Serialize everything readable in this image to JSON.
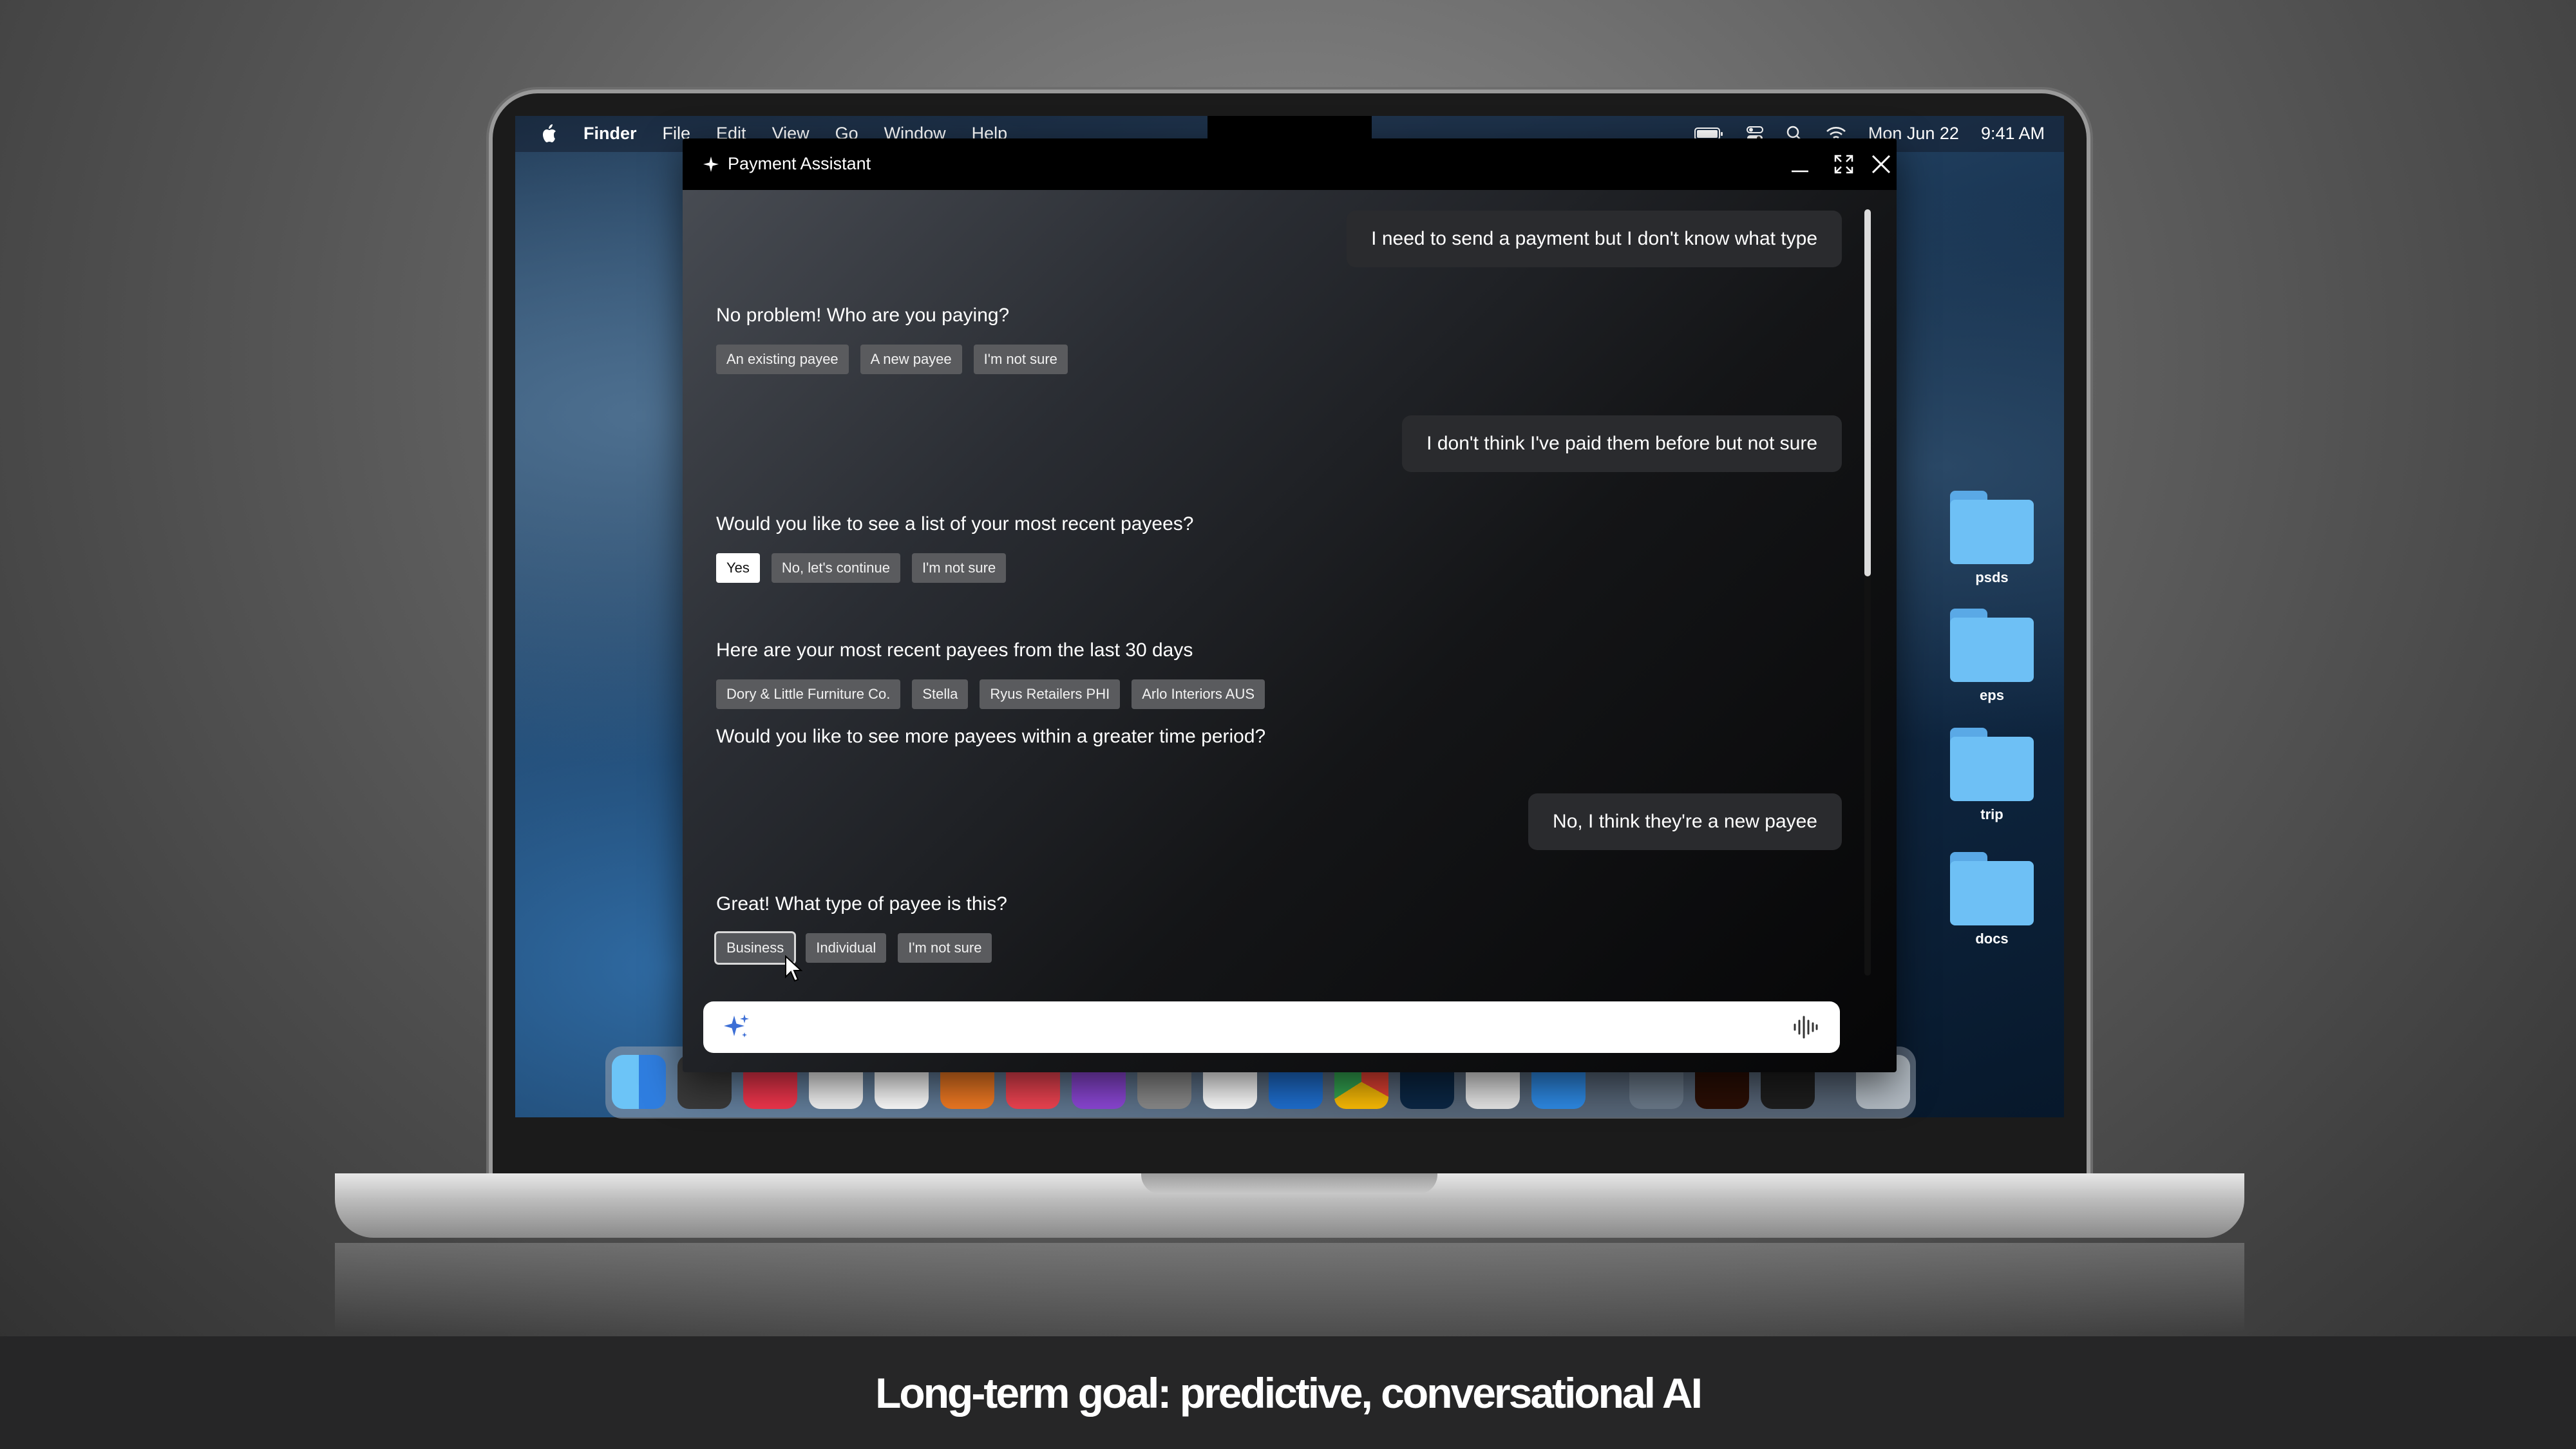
{
  "menubar": {
    "app": "Finder",
    "menus": [
      "File",
      "Edit",
      "View",
      "Go",
      "Window",
      "Help"
    ],
    "date": "Mon Jun 22",
    "time": "9:41 AM"
  },
  "window": {
    "title": "Payment Assistant",
    "conversation": [
      {
        "role": "user",
        "text": "I need to send a payment but I don't know what type"
      },
      {
        "role": "assistant",
        "text": "No problem!  Who are you paying?",
        "options": [
          "An existing payee",
          "A new payee",
          "I'm not sure"
        ]
      },
      {
        "role": "user",
        "text": "I don't think I've paid them before but not sure"
      },
      {
        "role": "assistant",
        "text": "Would you like to see a list of your most recent payees?",
        "options": [
          "Yes",
          "No, let's continue",
          "I'm not sure"
        ],
        "selected": "Yes"
      },
      {
        "role": "assistant",
        "text": "Here are your most recent payees from the last 30 days",
        "options": [
          "Dory & Little Furniture Co.",
          "Stella",
          "Ryus Retailers PHI",
          "Arlo Interiors AUS"
        ]
      },
      {
        "role": "assistant",
        "text": "Would you like to see more payees within a greater time period?"
      },
      {
        "role": "user",
        "text": "No, I think they're a new payee"
      },
      {
        "role": "assistant",
        "text": "Great!  What type of payee is this?",
        "options": [
          "Business",
          "Individual",
          "I'm not sure"
        ],
        "hovered": "Business"
      }
    ],
    "input": {
      "value": "",
      "left_icon": "sparkle-icon",
      "right_icon": "voice-waveform-icon"
    }
  },
  "desktop_folders": [
    "psds",
    "eps",
    "trip",
    "docs"
  ],
  "dock_apps": [
    "Finder",
    "Launchpad",
    "Music",
    "Reminders",
    "Freeform",
    "Instruments",
    "News",
    "Podcasts",
    "System Settings",
    "Slack",
    "Outlook",
    "Chrome",
    "Photoshop",
    "Notes",
    "Safari",
    "Preview",
    "Illustrator",
    "Figma",
    "Trash"
  ],
  "caption": "Long-term goal: predictive, conversational AI",
  "colors": {
    "accent_sparkle": "#3d6fd6",
    "folder": "#6ec0f5",
    "caption_bg": "#262627"
  }
}
